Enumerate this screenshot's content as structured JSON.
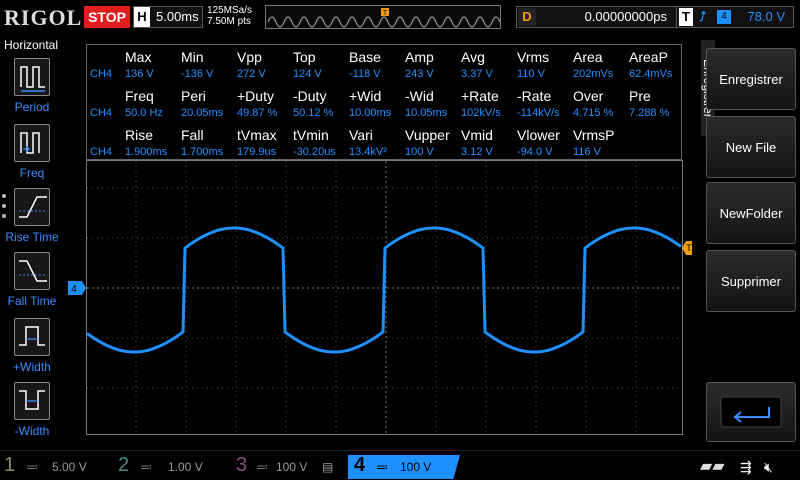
{
  "topbar": {
    "brand": "RIGOL",
    "run_state": "STOP",
    "h_label": "H",
    "timebase": "5.00ms",
    "sample_rate": "125MSa/s",
    "memory_depth": "7.50M pts",
    "delay_label": "D",
    "delay_value": "0.00000000ps",
    "trigger_label": "T",
    "trigger_source": "4",
    "trigger_level": "78.0 V"
  },
  "left_menu": {
    "title": "Horizontal",
    "items": [
      {
        "label": "Period",
        "icon": "period-icon"
      },
      {
        "label": "Freq",
        "icon": "frequency-icon"
      },
      {
        "label": "Rise Time",
        "icon": "rise-time-icon"
      },
      {
        "label": "Fall Time",
        "icon": "fall-time-icon"
      },
      {
        "label": "+Width",
        "icon": "positive-width-icon"
      },
      {
        "label": "-Width",
        "icon": "negative-width-icon"
      }
    ]
  },
  "measurements": {
    "channel_label": "CH4",
    "rows": [
      {
        "headers": [
          "Max",
          "Min",
          "Vpp",
          "Top",
          "Base",
          "Amp",
          "Avg",
          "Vrms",
          "Area",
          "AreaP"
        ],
        "values": [
          "136 V",
          "-136 V",
          "272 V",
          "124 V",
          "-118 V",
          "243 V",
          "3.37 V",
          "110 V",
          "202mVs",
          "62.4mVs"
        ]
      },
      {
        "headers": [
          "Freq",
          "Peri",
          "+Duty",
          "-Duty",
          "+Wid",
          "-Wid",
          "+Rate",
          "-Rate",
          "Over",
          "Pre"
        ],
        "values": [
          "50.0 Hz",
          "20.05ms",
          "49.87 %",
          "50.12 %",
          "10.00ms",
          "10.05ms",
          "102kV/s",
          "-114kV/s",
          "4.715 %",
          "7.288 %"
        ]
      },
      {
        "headers": [
          "Rise",
          "Fall",
          "tVmax",
          "tVmin",
          "Vari",
          "Vupper",
          "Vmid",
          "Vlower",
          "VrmsP",
          ""
        ],
        "values": [
          "1.900ms",
          "1.700ms",
          "179.9us",
          "-30.20us",
          "13.4kV²",
          "100 V",
          "3.12 V",
          "-94.0 V",
          "116 V",
          ""
        ]
      }
    ]
  },
  "markers": {
    "channel_marker": "4",
    "trigger_marker": "T"
  },
  "right_menu": {
    "side_label": "Enregistrer",
    "buttons": [
      "Enregistrer",
      "New File",
      "NewFolder",
      "Supprimer"
    ],
    "back_icon": "return-arrow-icon"
  },
  "bottombar": {
    "channels": [
      {
        "num": "1",
        "scale": "5.00 V",
        "color": "#f5e600"
      },
      {
        "num": "2",
        "scale": "1.00 V",
        "color": "#00e5e5"
      },
      {
        "num": "3",
        "scale": "100 V",
        "color": "#e05ce0"
      },
      {
        "num": "4",
        "scale": "100 V",
        "color": "#1e90ff"
      }
    ],
    "usb_icon": "usb-icon",
    "mute_icon": "speaker-muted-icon"
  },
  "colors": {
    "accent": "#1e90ff",
    "trigger": "#f39c12",
    "stop": "#e21d1d"
  }
}
